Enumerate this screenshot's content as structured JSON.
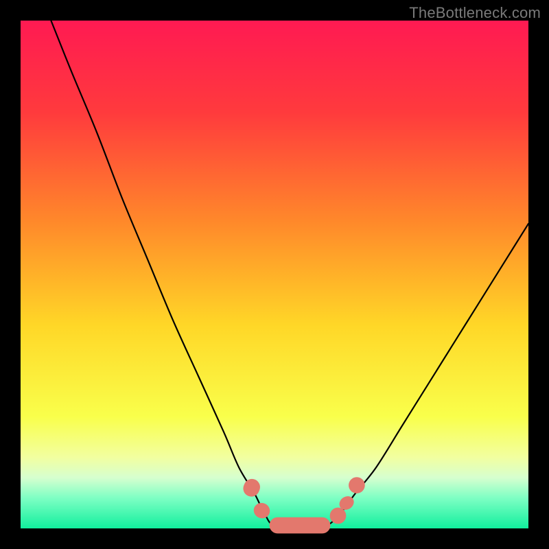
{
  "watermark": "TheBottleneck.com",
  "gradient_stops": [
    {
      "offset": 0,
      "color": "#ff1a52"
    },
    {
      "offset": 18,
      "color": "#ff3a3d"
    },
    {
      "offset": 40,
      "color": "#ff8a2a"
    },
    {
      "offset": 60,
      "color": "#ffd727"
    },
    {
      "offset": 78,
      "color": "#f9ff4b"
    },
    {
      "offset": 86,
      "color": "#f2ffa0"
    },
    {
      "offset": 90,
      "color": "#d6ffcf"
    },
    {
      "offset": 94,
      "color": "#7effc4"
    },
    {
      "offset": 100,
      "color": "#11ef9d"
    }
  ],
  "chart_data": {
    "type": "line",
    "title": "",
    "xlabel": "",
    "ylabel": "",
    "xlim": [
      0,
      100
    ],
    "ylim": [
      0,
      100
    ],
    "grid": false,
    "legend": false,
    "series": [
      {
        "name": "bottleneck-curve-left",
        "x": [
          6,
          10,
          15,
          20,
          25,
          30,
          35,
          40,
          43,
          46,
          48,
          50
        ],
        "y": [
          100,
          90,
          78,
          65,
          53,
          41,
          30,
          19,
          12,
          7,
          3,
          0.5
        ]
      },
      {
        "name": "bottleneck-curve-flat",
        "x": [
          50,
          55,
          60
        ],
        "y": [
          0.5,
          0.5,
          0.5
        ]
      },
      {
        "name": "bottleneck-curve-right",
        "x": [
          60,
          63,
          66,
          70,
          75,
          80,
          85,
          90,
          95,
          100
        ],
        "y": [
          0.5,
          3,
          7,
          12,
          20,
          28,
          36,
          44,
          52,
          60
        ]
      }
    ],
    "markers": [
      {
        "kind": "capsule",
        "cx": 45.5,
        "cy": 8.0,
        "len": 3.5,
        "r": 1.6,
        "angle": 68
      },
      {
        "kind": "capsule",
        "cx": 47.5,
        "cy": 3.5,
        "len": 3.0,
        "r": 1.6,
        "angle": 68
      },
      {
        "kind": "capsule",
        "cx": 55.0,
        "cy": 0.6,
        "len": 12.0,
        "r": 1.6,
        "angle": 0
      },
      {
        "kind": "dot",
        "cx": 62.5,
        "cy": 2.5,
        "r": 1.6
      },
      {
        "kind": "capsule",
        "cx": 64.2,
        "cy": 5.0,
        "len": 2.5,
        "r": 1.5,
        "angle": -55
      },
      {
        "kind": "dot",
        "cx": 66.2,
        "cy": 8.5,
        "r": 1.6
      }
    ]
  }
}
